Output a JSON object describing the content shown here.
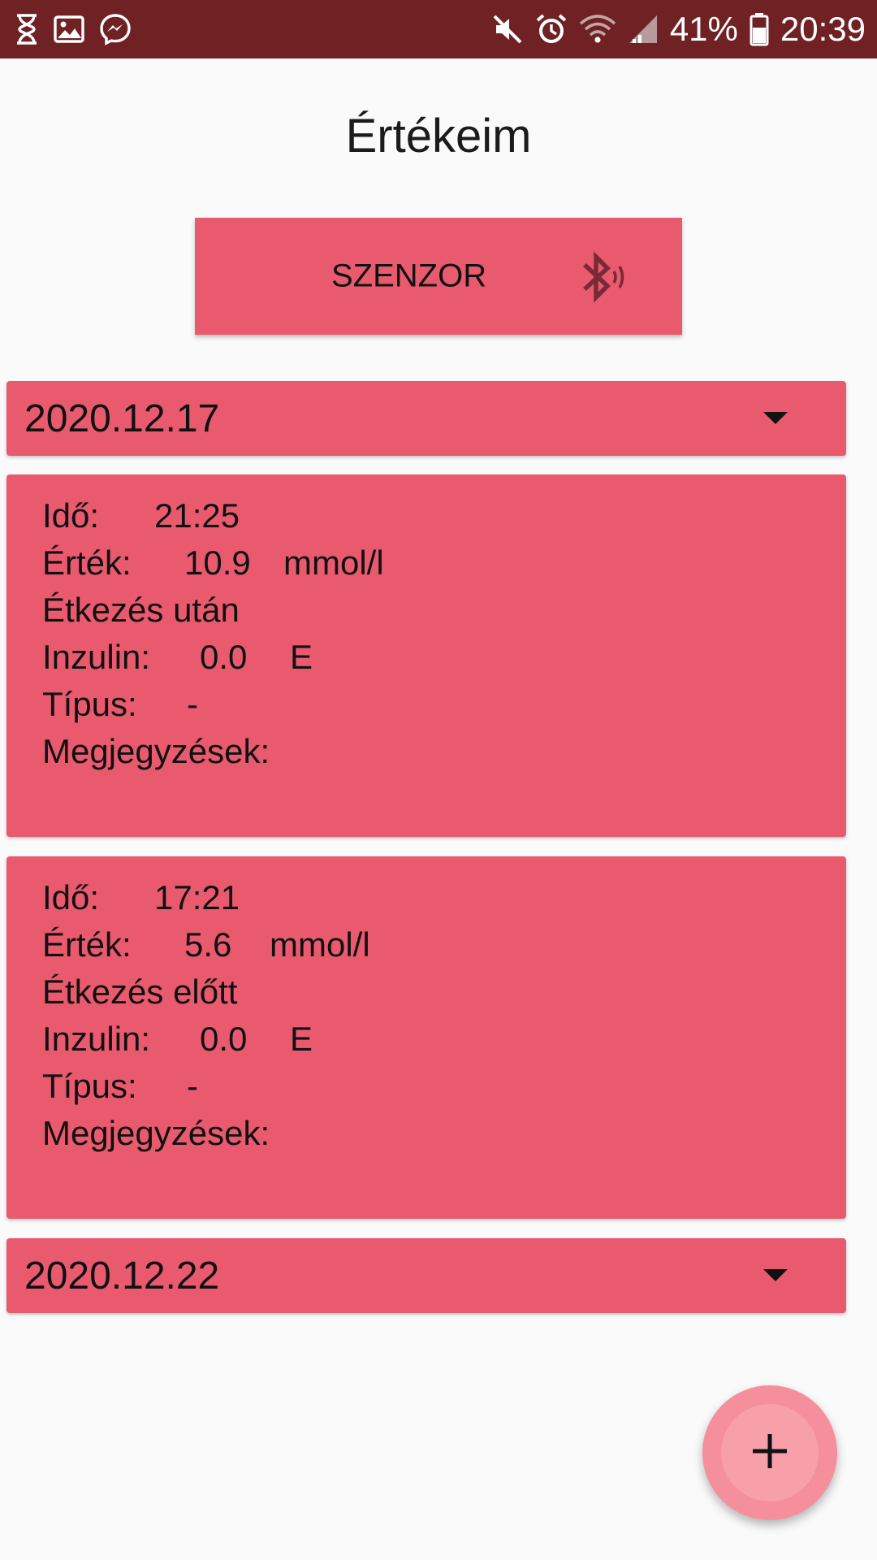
{
  "status_bar": {
    "battery_percent": "41%",
    "time": "20:39",
    "left_icons": [
      "hourglass-icon",
      "image-icon",
      "messenger-icon"
    ],
    "right_icons": [
      "mute-icon",
      "alarm-icon",
      "wifi-icon",
      "signal-icon",
      "battery-icon"
    ]
  },
  "title": "Értékeim",
  "sensor_button": {
    "label": "SZENZOR",
    "icon": "bluetooth-icon"
  },
  "groups": [
    {
      "date": "2020.12.17",
      "entries": [
        {
          "time_label": "Idő:",
          "time": "21:25",
          "value_label": "Érték:",
          "value": "10.9",
          "unit": "mmol/l",
          "meal": "Étkezés után",
          "insulin_label": "Inzulin:",
          "insulin": "0.0",
          "insulin_unit": "E",
          "type_label": "Típus:",
          "type": "-",
          "notes_label": "Megjegyzések:"
        },
        {
          "time_label": "Idő:",
          "time": "17:21",
          "value_label": "Érték:",
          "value": "5.6",
          "unit": "mmol/l",
          "meal": "Étkezés előtt",
          "insulin_label": "Inzulin:",
          "insulin": "0.0",
          "insulin_unit": "E",
          "type_label": "Típus:",
          "type": "-",
          "notes_label": "Megjegyzések:"
        }
      ]
    },
    {
      "date": "2020.12.22",
      "entries": []
    }
  ],
  "fab": {
    "icon": "plus-icon"
  },
  "colors": {
    "status_bar": "#6f2124",
    "accent": "#e95a6f",
    "fab": "#f58f9c",
    "background": "#fafafa"
  }
}
